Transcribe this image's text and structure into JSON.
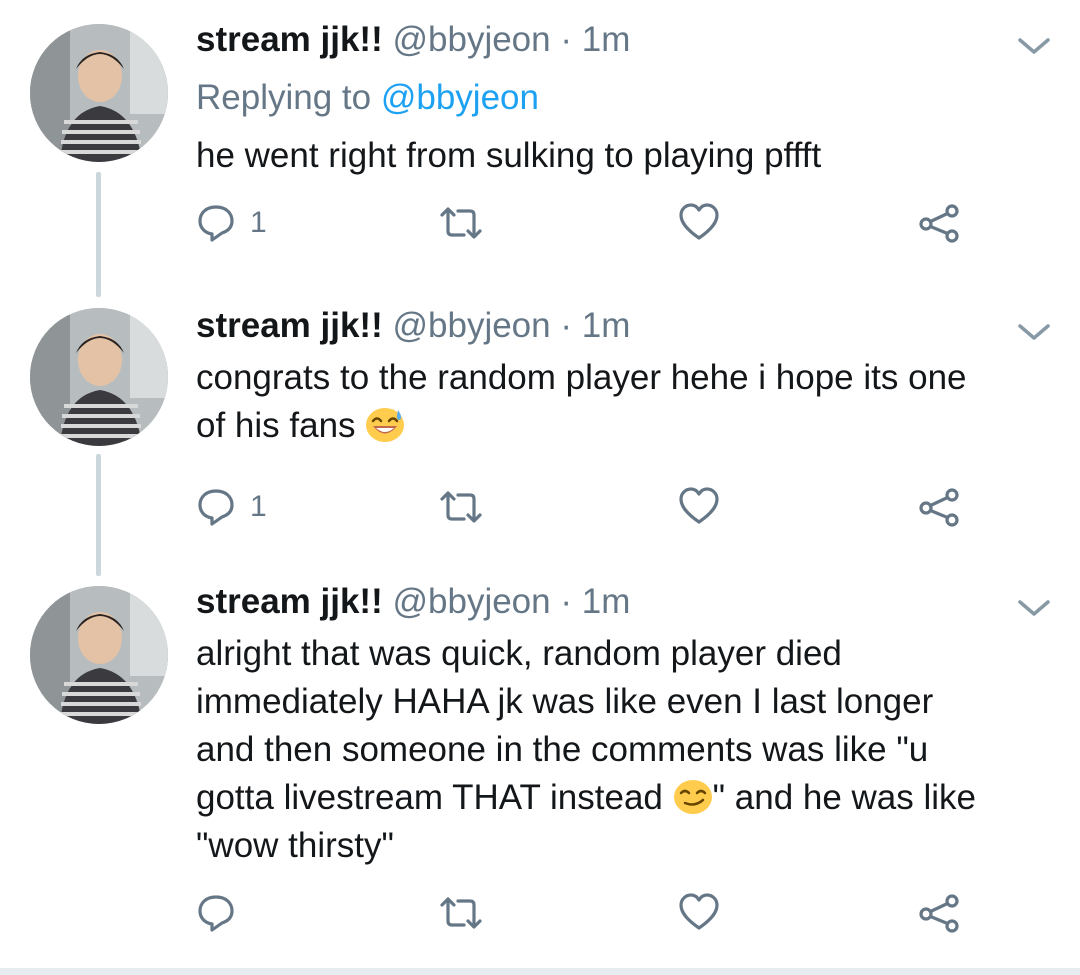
{
  "tweets": [
    {
      "name": "stream jjk!!",
      "handle": "@bbyjeon",
      "dot": "·",
      "time": "1m",
      "reply_prefix": "Replying to ",
      "reply_mention": "@bbyjeon",
      "text_lines": [
        "he went right from sulking to playing pffft"
      ],
      "reply_count": "1"
    },
    {
      "name": "stream jjk!!",
      "handle": "@bbyjeon",
      "dot": "·",
      "time": "1m",
      "text_lines": [
        "congrats to the random player hehe i hope its one",
        "of his fans "
      ],
      "emoji": "sweat-smile-emoji",
      "reply_count": "1"
    },
    {
      "name": "stream jjk!!",
      "handle": "@bbyjeon",
      "dot": "·",
      "time": "1m",
      "text_lines": [
        "alright that was quick, random player died",
        "immediately HAHA jk was like even I last longer",
        "and then someone in the comments was like \"u",
        "gotta livestream THAT instead ",
        "\" and he was like",
        "\"wow thirsty\""
      ],
      "emoji": "smirk-emoji",
      "reply_count": ""
    }
  ],
  "icons": {
    "reply": "reply-icon",
    "retweet": "retweet-icon",
    "like": "like-icon",
    "share": "share-icon",
    "caret": "chevron-down-icon"
  },
  "colors": {
    "secondary_text": "#657786",
    "link": "#1da1f2",
    "thread_line": "#ccd6dd",
    "emoji_yellow": "#ffcc4d"
  }
}
